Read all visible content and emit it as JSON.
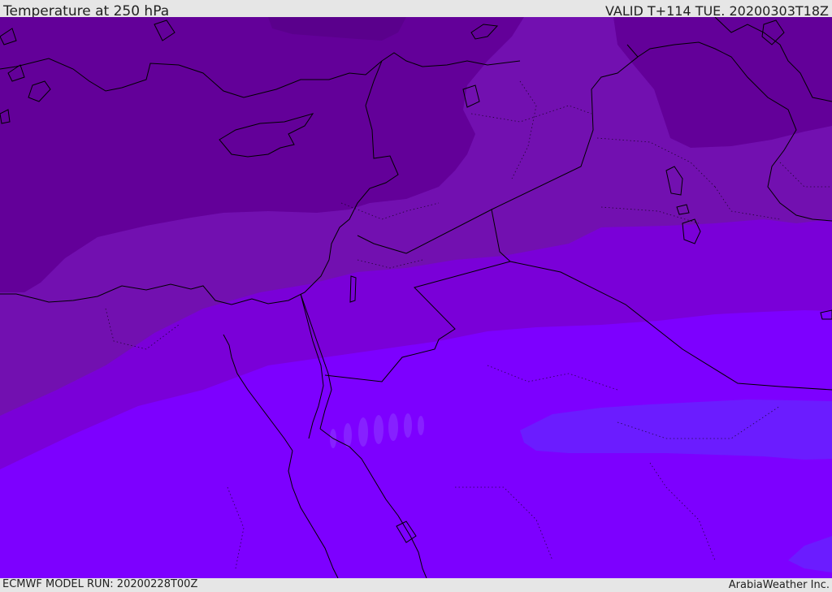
{
  "header": {
    "title": "Temperature at 250 hPa",
    "valid": "VALID T+114 TUE. 20200303T18Z"
  },
  "footer": {
    "model_run": "ECMWF MODEL RUN: 20200228T00Z",
    "credit": "ArabiaWeather Inc."
  },
  "colors": {
    "band_coldest": "#630099",
    "band_cold": "#7210b0",
    "band_mid": "#7a00d8",
    "band_warm": "#7d00ff",
    "band_warmest": "#6b1cff",
    "coastline": "#000000",
    "bar_background": "#e6e6e6"
  }
}
